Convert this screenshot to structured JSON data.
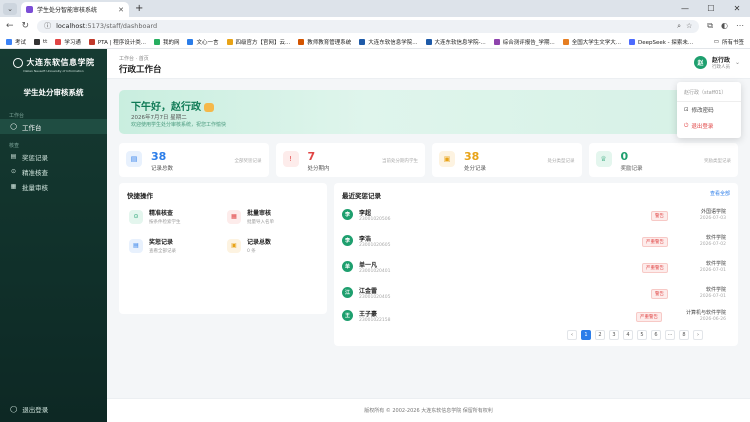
{
  "browser": {
    "tab_title": "学生处分智能审核系统",
    "url_host": "localhost",
    "url_path": ":5173/staff/dashboard",
    "bookmarks": [
      "考试",
      "tt",
      "学习通",
      "PTA | 程序设计类...",
      "我的网",
      "文心一言",
      "四级官方【官网】云...",
      "教师教育管理系统",
      "大连东软信息学院...",
      "大连东软信息学院-...",
      "综合测评报告_学期...",
      "全国大学生文学大...",
      "DeepSeek - 探索未..."
    ],
    "bookmarks_right": "所有书签"
  },
  "sidebar": {
    "logo_cn": "大连东软信息学院",
    "logo_en": "Dalian Neusoft University of Information",
    "system_title": "学生处分审核系统",
    "group_workbench": "工作台",
    "group_business": "核查",
    "items": [
      {
        "label": "工作台",
        "icon": "◯"
      },
      {
        "label": "奖惩记录",
        "icon": "▤"
      },
      {
        "label": "精准核查",
        "icon": "⊙"
      },
      {
        "label": "批量审核",
        "icon": "▦"
      }
    ],
    "logout": "退出登录"
  },
  "header": {
    "breadcrumb": "工作台 · 首页",
    "title": "行政工作台",
    "user_initial": "赵",
    "user_name": "赵行政",
    "user_role": "行政人员"
  },
  "dropdown": {
    "account": "赵行政（staff01）",
    "change_password": "修改密码",
    "logout": "退出登录"
  },
  "banner": {
    "greeting": "下午好，赵行政",
    "date": "2026年7月7日 星期二",
    "subtitle": "欢迎使用学生处分审核系统，祝您工作愉快"
  },
  "stats": [
    {
      "value": "38",
      "label": "记录总数",
      "hint": "全部奖惩记录",
      "icon": "▤",
      "color": "#2b7de9",
      "bg": "#e8f1fd"
    },
    {
      "value": "7",
      "label": "处分期内",
      "hint": "当前处分期内学生",
      "icon": "!",
      "color": "#e04545",
      "bg": "#fdeceb"
    },
    {
      "value": "38",
      "label": "处分记录",
      "hint": "处分类型记录",
      "icon": "▣",
      "color": "#e8a317",
      "bg": "#fdf3e1"
    },
    {
      "value": "0",
      "label": "奖励记录",
      "hint": "奖励类型记录",
      "icon": "♕",
      "color": "#1e9f6e",
      "bg": "#e4f6ee"
    }
  ],
  "quick_actions": {
    "title": "快捷操作",
    "items": [
      {
        "title": "精准核查",
        "sub": "按条件检索学生",
        "icon": "⊙",
        "color": "#1e9f6e",
        "bg": "#e4f6ee"
      },
      {
        "title": "批量审核",
        "sub": "批量导入名单",
        "icon": "▦",
        "color": "#e04545",
        "bg": "#fdeceb"
      },
      {
        "title": "奖惩记录",
        "sub": "查看全部记录",
        "icon": "▤",
        "color": "#2b7de9",
        "bg": "#e8f1fd"
      },
      {
        "title": "记录总数",
        "sub": "0 条",
        "icon": "▣",
        "color": "#e8a317",
        "bg": "#fdf3e1"
      }
    ]
  },
  "recent": {
    "title": "最近奖惩记录",
    "view_all": "查看全部",
    "rows": [
      {
        "initial": "李",
        "name": "李超",
        "id": "23001020506",
        "badge": "警告",
        "dept": "外国语学院",
        "date": "2026-07-03"
      },
      {
        "initial": "李",
        "name": "李浩",
        "id": "23001020605",
        "badge": "严重警告",
        "dept": "软件学院",
        "date": "2026-07-02"
      },
      {
        "initial": "单",
        "name": "单一凡",
        "id": "23001020401",
        "badge": "严重警告",
        "dept": "软件学院",
        "date": "2026-07-01"
      },
      {
        "initial": "江",
        "name": "江金雷",
        "id": "23001020405",
        "badge": "警告",
        "dept": "软件学院",
        "date": "2026-07-01"
      },
      {
        "initial": "王",
        "name": "王子豪",
        "id": "23001022158",
        "badge": "严重警告",
        "dept": "计算机与软件学院",
        "date": "2026-06-26"
      }
    ],
    "pager": {
      "prev": "‹",
      "pages": [
        "1",
        "2",
        "3",
        "4",
        "5",
        "6",
        "···",
        "8"
      ],
      "next": "›"
    }
  },
  "footer": "版权所有 © 2002-2026 大连东软信息学院 保留所有权利"
}
